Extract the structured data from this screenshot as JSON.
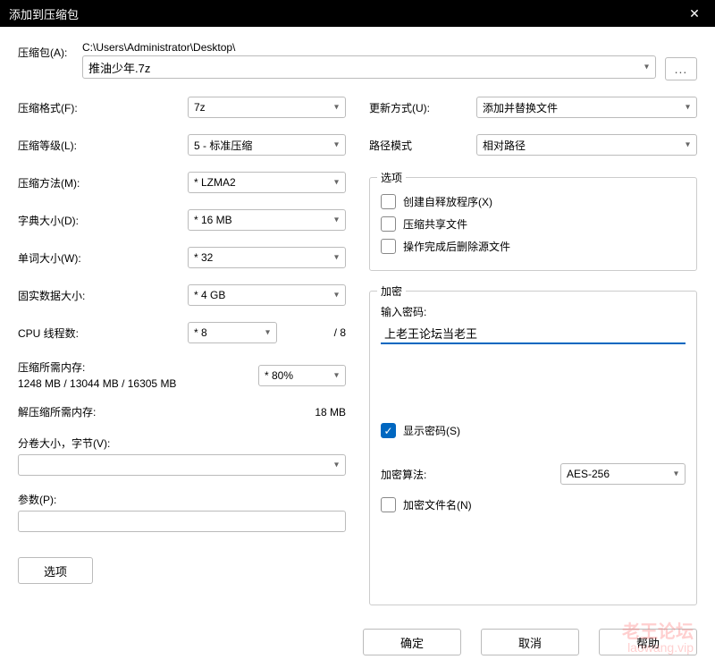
{
  "title": "添加到压缩包",
  "archive": {
    "label": "压缩包(A):",
    "path": "C:\\Users\\Administrator\\Desktop\\",
    "filename": "推油少年.7z",
    "browse": "..."
  },
  "left": {
    "format": {
      "label": "压缩格式(F):",
      "value": "7z"
    },
    "level": {
      "label": "压缩等级(L):",
      "value": "5 - 标准压缩"
    },
    "method": {
      "label": "压缩方法(M):",
      "value": "* LZMA2"
    },
    "dict": {
      "label": "字典大小(D):",
      "value": "* 16 MB"
    },
    "word": {
      "label": "单词大小(W):",
      "value": "* 32"
    },
    "solid": {
      "label": "固实数据大小:",
      "value": "* 4 GB"
    },
    "threads": {
      "label": "CPU 线程数:",
      "value": "* 8",
      "suffix": "/ 8"
    },
    "mem_compress": {
      "label1": "压缩所需内存:",
      "label2": "1248 MB / 13044 MB / 16305 MB",
      "value": "* 80%"
    },
    "mem_decompress": {
      "label": "解压缩所需内存:",
      "value": "18 MB"
    },
    "volume": {
      "label": "分卷大小，字节(V):",
      "value": ""
    },
    "params": {
      "label": "参数(P):",
      "value": ""
    },
    "options_btn": "选项"
  },
  "right": {
    "update": {
      "label": "更新方式(U):",
      "value": "添加并替换文件"
    },
    "pathmode": {
      "label": "路径模式",
      "value": "相对路径"
    },
    "options_legend": "选项",
    "opt_sfx": "创建自释放程序(X)",
    "opt_shared": "压缩共享文件",
    "opt_delete": "操作完成后删除源文件",
    "enc_legend": "加密",
    "enc_pwd_label": "输入密码:",
    "enc_pwd_value": "上老王论坛当老王",
    "enc_show": "显示密码(S)",
    "enc_algo_label": "加密算法:",
    "enc_algo_value": "AES-256",
    "enc_names": "加密文件名(N)"
  },
  "footer": {
    "ok": "确定",
    "cancel": "取消",
    "help": "帮助"
  },
  "watermark": {
    "line1": "老王论坛",
    "line2": "laowang.vip"
  }
}
